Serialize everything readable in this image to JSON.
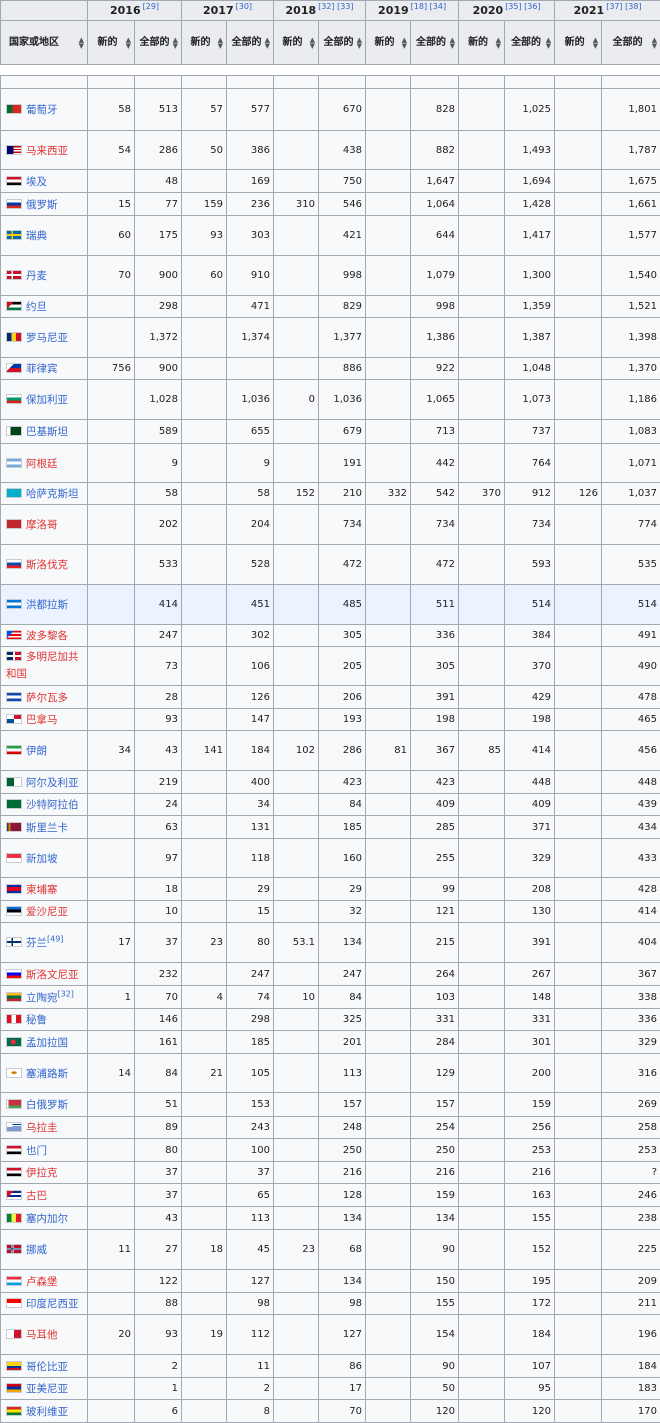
{
  "header": {
    "country_label": "国家或地区",
    "years": [
      {
        "year": "2016",
        "ref": "[29]"
      },
      {
        "year": "2017",
        "ref": "[30]"
      },
      {
        "year": "2018",
        "ref": "[32] [33]"
      },
      {
        "year": "2019",
        "ref": "[18] [34]"
      },
      {
        "year": "2020",
        "ref": "[35] [36]"
      },
      {
        "year": "2021",
        "ref": "[37] [38]"
      }
    ],
    "sub_new": "新的",
    "sub_total": "全部的",
    "sub_total_wrap": "全部的"
  },
  "colors": {
    "link": "#3366cc",
    "redlink": "#d33",
    "border": "#a2a9b1",
    "header_bg": "#eaecf0",
    "cell_bg": "#f8f9fa",
    "highlight_bg": "#eaf3ff"
  },
  "rows": [
    {
      "name": "葡萄牙",
      "flag": "portugal-flag",
      "c": [
        "58",
        "513",
        "57",
        "577",
        "",
        "670",
        "",
        "828",
        "",
        "1,025",
        "",
        "1,801"
      ]
    },
    {
      "name": "马来西亚",
      "flag": "malaysia-flag",
      "red": true,
      "c": [
        "54",
        "286",
        "50",
        "386",
        "",
        "438",
        "",
        "882",
        "",
        "1,493",
        "",
        "1,787"
      ]
    },
    {
      "name": "埃及",
      "flag": "egypt-flag",
      "c": [
        "",
        "48",
        "",
        "169",
        "",
        "750",
        "",
        "1,647",
        "",
        "1,694",
        "",
        "1,675"
      ]
    },
    {
      "name": "俄罗斯",
      "flag": "russia-flag",
      "c": [
        "15",
        "77",
        "159",
        "236",
        "310",
        "546",
        "",
        "1,064",
        "",
        "1,428",
        "",
        "1,661"
      ]
    },
    {
      "name": "瑞典",
      "flag": "sweden-flag",
      "c": [
        "60",
        "175",
        "93",
        "303",
        "",
        "421",
        "",
        "644",
        "",
        "1,417",
        "",
        "1,577"
      ]
    },
    {
      "name": "丹麦",
      "flag": "denmark-flag",
      "c": [
        "70",
        "900",
        "60",
        "910",
        "",
        "998",
        "",
        "1,079",
        "",
        "1,300",
        "",
        "1,540"
      ]
    },
    {
      "name": "约旦",
      "flag": "jordan-flag",
      "c": [
        "",
        "298",
        "",
        "471",
        "",
        "829",
        "",
        "998",
        "",
        "1,359",
        "",
        "1,521"
      ]
    },
    {
      "name": "罗马尼亚",
      "flag": "romania-flag",
      "c": [
        "",
        "1,372",
        "",
        "1,374",
        "",
        "1,377",
        "",
        "1,386",
        "",
        "1,387",
        "",
        "1,398"
      ]
    },
    {
      "name": "菲律宾",
      "flag": "philippines-flag",
      "c": [
        "756",
        "900",
        "",
        "",
        "",
        "886",
        "",
        "922",
        "",
        "1,048",
        "",
        "1,370"
      ]
    },
    {
      "name": "保加利亚",
      "flag": "bulgaria-flag",
      "c": [
        "",
        "1,028",
        "",
        "1,036",
        "0",
        "1,036",
        "",
        "1,065",
        "",
        "1,073",
        "",
        "1,186"
      ]
    },
    {
      "name": "巴基斯坦",
      "flag": "pakistan-flag",
      "c": [
        "",
        "589",
        "",
        "655",
        "",
        "679",
        "",
        "713",
        "",
        "737",
        "",
        "1,083"
      ]
    },
    {
      "name": "阿根廷",
      "flag": "argentina-flag",
      "red": true,
      "c": [
        "",
        "9",
        "",
        "9",
        "",
        "191",
        "",
        "442",
        "",
        "764",
        "",
        "1,071"
      ]
    },
    {
      "name": "哈萨克斯坦",
      "flag": "kazakhstan-flag",
      "c": [
        "",
        "58",
        "",
        "58",
        "152",
        "210",
        "332",
        "542",
        "370",
        "912",
        "126",
        "1,037"
      ]
    },
    {
      "name": "摩洛哥",
      "flag": "morocco-flag",
      "red": true,
      "c": [
        "",
        "202",
        "",
        "204",
        "",
        "734",
        "",
        "734",
        "",
        "734",
        "",
        "774"
      ]
    },
    {
      "name": "斯洛伐克",
      "flag": "slovakia-flag",
      "red": true,
      "c": [
        "",
        "533",
        "",
        "528",
        "",
        "472",
        "",
        "472",
        "",
        "593",
        "",
        "535"
      ]
    },
    {
      "name": "洪都拉斯",
      "flag": "honduras-flag",
      "hl": true,
      "c": [
        "",
        "414",
        "",
        "451",
        "",
        "485",
        "",
        "511",
        "",
        "514",
        "",
        "514"
      ]
    },
    {
      "name": "波多黎各",
      "flag": "puerto-rico-flag",
      "red": true,
      "c": [
        "",
        "247",
        "",
        "302",
        "",
        "305",
        "",
        "336",
        "",
        "384",
        "",
        "491"
      ]
    },
    {
      "name": "多明尼加共和国",
      "flag": "dominican-flag",
      "red": true,
      "c": [
        "",
        "73",
        "",
        "106",
        "",
        "205",
        "",
        "305",
        "",
        "370",
        "",
        "490"
      ]
    },
    {
      "name": "萨尔瓦多",
      "flag": "el-salvador-flag",
      "red": true,
      "c": [
        "",
        "28",
        "",
        "126",
        "",
        "206",
        "",
        "391",
        "",
        "429",
        "",
        "478"
      ]
    },
    {
      "name": "巴拿马",
      "flag": "panama-flag",
      "red": true,
      "c": [
        "",
        "93",
        "",
        "147",
        "",
        "193",
        "",
        "198",
        "",
        "198",
        "",
        "465"
      ]
    },
    {
      "name": "伊朗",
      "flag": "iran-flag",
      "c": [
        "34",
        "43",
        "141",
        "184",
        "102",
        "286",
        "81",
        "367",
        "85",
        "414",
        "",
        "456"
      ]
    },
    {
      "name": "阿尔及利亚",
      "flag": "algeria-flag",
      "c": [
        "",
        "219",
        "",
        "400",
        "",
        "423",
        "",
        "423",
        "",
        "448",
        "",
        "448"
      ]
    },
    {
      "name": "沙特阿拉伯",
      "flag": "saudi-flag",
      "c": [
        "",
        "24",
        "",
        "34",
        "",
        "84",
        "",
        "409",
        "",
        "409",
        "",
        "439"
      ]
    },
    {
      "name": "斯里兰卡",
      "flag": "sri-lanka-flag",
      "c": [
        "",
        "63",
        "",
        "131",
        "",
        "185",
        "",
        "285",
        "",
        "371",
        "",
        "434"
      ]
    },
    {
      "name": "新加坡",
      "flag": "singapore-flag",
      "c": [
        "",
        "97",
        "",
        "118",
        "",
        "160",
        "",
        "255",
        "",
        "329",
        "",
        "433"
      ]
    },
    {
      "name": "柬埔寨",
      "flag": "cambodia-flag",
      "red": true,
      "c": [
        "",
        "18",
        "",
        "29",
        "",
        "29",
        "",
        "99",
        "",
        "208",
        "",
        "428"
      ]
    },
    {
      "name": "爱沙尼亚",
      "flag": "estonia-flag",
      "red": true,
      "c": [
        "",
        "10",
        "",
        "15",
        "",
        "32",
        "",
        "121",
        "",
        "130",
        "",
        "414"
      ]
    },
    {
      "name": "芬兰",
      "ref": "[49]",
      "flag": "finland-flag",
      "c": [
        "17",
        "37",
        "23",
        "80",
        "53.1",
        "134",
        "",
        "215",
        "",
        "391",
        "",
        "404"
      ]
    },
    {
      "name": "斯洛文尼亚",
      "flag": "slovenia-flag",
      "red": true,
      "c": [
        "",
        "232",
        "",
        "247",
        "",
        "247",
        "",
        "264",
        "",
        "267",
        "",
        "367"
      ]
    },
    {
      "name": "立陶宛",
      "ref": "[32]",
      "flag": "lithuania-flag",
      "c": [
        "1",
        "70",
        "4",
        "74",
        "10",
        "84",
        "",
        "103",
        "",
        "148",
        "",
        "338"
      ]
    },
    {
      "name": "秘鲁",
      "flag": "peru-flag",
      "c": [
        "",
        "146",
        "",
        "298",
        "",
        "325",
        "",
        "331",
        "",
        "331",
        "",
        "336"
      ]
    },
    {
      "name": "孟加拉国",
      "flag": "bangladesh-flag",
      "c": [
        "",
        "161",
        "",
        "185",
        "",
        "201",
        "",
        "284",
        "",
        "301",
        "",
        "329"
      ]
    },
    {
      "name": "塞浦路斯",
      "flag": "cyprus-flag",
      "c": [
        "14",
        "84",
        "21",
        "105",
        "",
        "113",
        "",
        "129",
        "",
        "200",
        "",
        "316"
      ]
    },
    {
      "name": "白俄罗斯",
      "flag": "belarus-flag",
      "c": [
        "",
        "51",
        "",
        "153",
        "",
        "157",
        "",
        "157",
        "",
        "159",
        "",
        "269"
      ]
    },
    {
      "name": "乌拉圭",
      "flag": "uruguay-flag",
      "red": true,
      "c": [
        "",
        "89",
        "",
        "243",
        "",
        "248",
        "",
        "254",
        "",
        "256",
        "",
        "258"
      ]
    },
    {
      "name": "也门",
      "flag": "yemen-flag",
      "c": [
        "",
        "80",
        "",
        "100",
        "",
        "250",
        "",
        "250",
        "",
        "253",
        "",
        "253"
      ]
    },
    {
      "name": "伊拉克",
      "flag": "iraq-flag",
      "red": true,
      "c": [
        "",
        "37",
        "",
        "37",
        "",
        "216",
        "",
        "216",
        "",
        "216",
        "",
        "?"
      ]
    },
    {
      "name": "古巴",
      "flag": "cuba-flag",
      "red": true,
      "c": [
        "",
        "37",
        "",
        "65",
        "",
        "128",
        "",
        "159",
        "",
        "163",
        "",
        "246"
      ]
    },
    {
      "name": "塞内加尔",
      "flag": "senegal-flag",
      "c": [
        "",
        "43",
        "",
        "113",
        "",
        "134",
        "",
        "134",
        "",
        "155",
        "",
        "238"
      ]
    },
    {
      "name": "挪威",
      "flag": "norway-flag",
      "c": [
        "11",
        "27",
        "18",
        "45",
        "23",
        "68",
        "",
        "90",
        "",
        "152",
        "",
        "225"
      ]
    },
    {
      "name": "卢森堡",
      "flag": "luxembourg-flag",
      "red": true,
      "c": [
        "",
        "122",
        "",
        "127",
        "",
        "134",
        "",
        "150",
        "",
        "195",
        "",
        "209"
      ]
    },
    {
      "name": "印度尼西亚",
      "flag": "indonesia-flag",
      "c": [
        "",
        "88",
        "",
        "98",
        "",
        "98",
        "",
        "155",
        "",
        "172",
        "",
        "211"
      ]
    },
    {
      "name": "马耳他",
      "flag": "malta-flag",
      "red": true,
      "c": [
        "20",
        "93",
        "19",
        "112",
        "",
        "127",
        "",
        "154",
        "",
        "184",
        "",
        "196"
      ]
    },
    {
      "name": "哥伦比亚",
      "flag": "colombia-flag",
      "c": [
        "",
        "2",
        "",
        "11",
        "",
        "86",
        "",
        "90",
        "",
        "107",
        "",
        "184"
      ]
    },
    {
      "name": "亚美尼亚",
      "flag": "armenia-flag",
      "c": [
        "",
        "1",
        "",
        "2",
        "",
        "17",
        "",
        "50",
        "",
        "95",
        "",
        "183"
      ]
    },
    {
      "name": "玻利维亚",
      "flag": "bolivia-flag",
      "c": [
        "",
        "6",
        "",
        "8",
        "",
        "70",
        "",
        "120",
        "",
        "120",
        "",
        "170"
      ]
    }
  ]
}
